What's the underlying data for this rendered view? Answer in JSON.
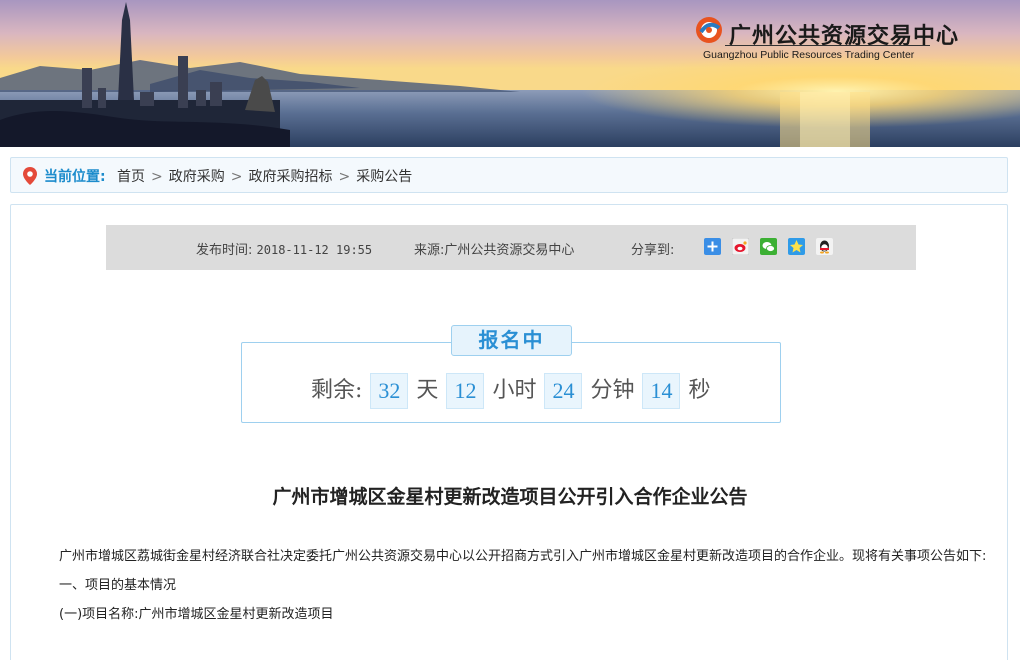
{
  "header": {
    "logo_cn": "广州公共资源交易中心",
    "logo_en": "Guangzhou Public Resources Trading Center"
  },
  "breadcrumb": {
    "label": "当前位置:",
    "items": [
      "首页",
      "政府采购",
      "政府采购招标",
      "采购公告"
    ],
    "separator": ">"
  },
  "meta": {
    "time_label": "发布时间:",
    "time_value": "2018-11-12 19:55",
    "source_label": "来源:",
    "source_value": "广州公共资源交易中心",
    "share_label": "分享到:",
    "share_icons": [
      "add-share-icon",
      "weibo-icon",
      "wechat-icon",
      "qzone-icon",
      "qq-icon"
    ]
  },
  "countdown": {
    "status": "报名中",
    "prefix": "剩余:",
    "days": "32",
    "days_unit": "天",
    "hours": "12",
    "hours_unit": "小时",
    "minutes": "24",
    "minutes_unit": "分钟",
    "seconds": "14",
    "seconds_unit": "秒"
  },
  "article": {
    "title": "广州市增城区金星村更新改造项目公开引入合作企业公告",
    "para1": "广州市增城区荔城街金星村经济联合社决定委托广州公共资源交易中心以公开招商方式引入广州市增城区金星村更新改造项目的合作企业。现将有关事项公告如下:",
    "section1": "一、项目的基本情况",
    "item1": "(一)项目名称:广州市增城区金星村更新改造项目"
  },
  "colors": {
    "accent": "#2a8fd4",
    "crumb_label": "#1c8ccc",
    "meta_bar": "#dcdcdc",
    "border": "#cfe3f1"
  }
}
